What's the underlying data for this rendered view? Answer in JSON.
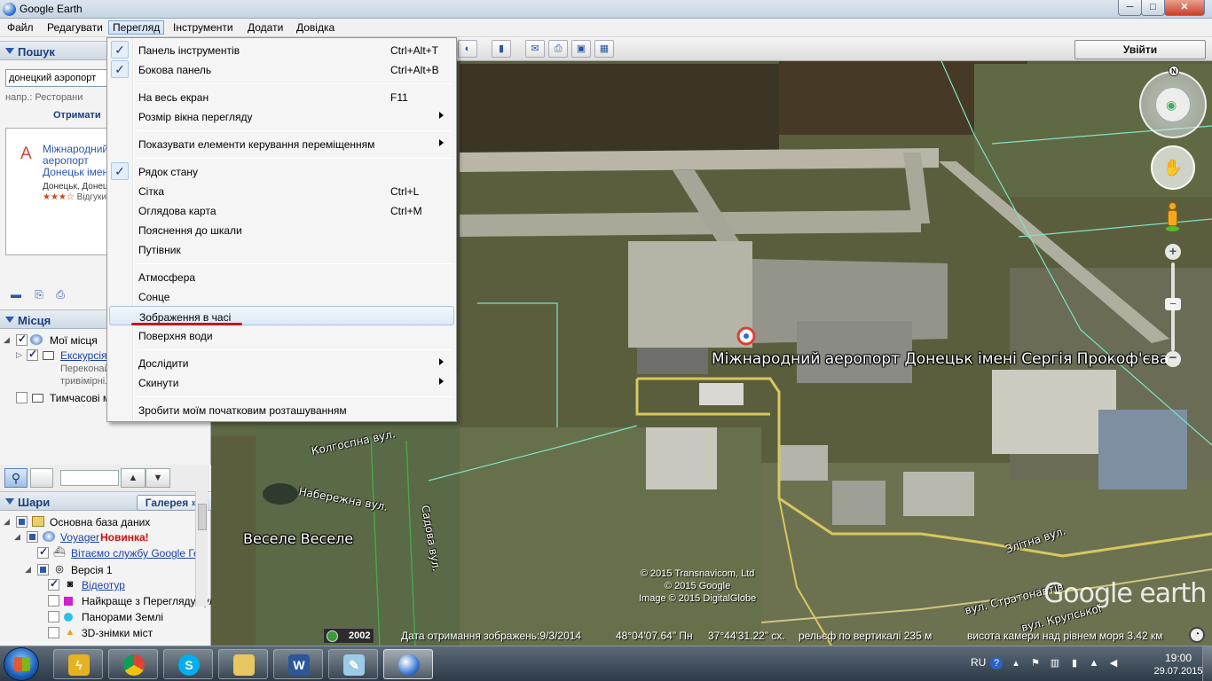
{
  "window": {
    "title": "Google Earth",
    "min": "─",
    "max": "□",
    "close": "✕"
  },
  "menubar": {
    "items": [
      "Файл",
      "Редагувати",
      "Перегляд",
      "Інструменти",
      "Додати",
      "Довідка"
    ]
  },
  "view_menu": {
    "items": [
      {
        "label": "Панель інструментів",
        "shortcut": "Ctrl+Alt+T",
        "checked": true
      },
      {
        "label": "Бокова панель",
        "shortcut": "Ctrl+Alt+B",
        "checked": true
      },
      {
        "label": "На весь екран",
        "shortcut": "F11"
      },
      {
        "label": "Розмір вікна перегляду",
        "submenu": true
      },
      {
        "label": "Показувати елементи керування переміщенням",
        "submenu": true
      },
      {
        "label": "Рядок стану",
        "checked": true
      },
      {
        "label": "Сітка",
        "shortcut": "Ctrl+L"
      },
      {
        "label": "Оглядова карта",
        "shortcut": "Ctrl+M"
      },
      {
        "label": "Пояснення до шкали"
      },
      {
        "label": "Путівник"
      },
      {
        "label": "Атмосфера"
      },
      {
        "label": "Сонце"
      },
      {
        "label": "Зображення в часі",
        "highlighted": true
      },
      {
        "label": "Поверхня води"
      },
      {
        "label": "Дослідити",
        "submenu": true
      },
      {
        "label": "Скинути",
        "submenu": true
      },
      {
        "label": "Зробити моїм початковим розташуванням"
      }
    ]
  },
  "search": {
    "header": "Пошук",
    "query": "донецкий аэропорт",
    "hint": "напр.: Ресторани",
    "get_directions": "Отримати",
    "result": {
      "marker": "A",
      "title": "Міжнародний аеропорт Донецьк імені Сергія Прокоф'єва",
      "city": "Донецьк, Донецька",
      "stars": "★★★",
      "reviews": "Відгуки"
    }
  },
  "places": {
    "header": "Місця",
    "items": [
      {
        "label": "Мої місця"
      },
      {
        "label": "Екскурсія",
        "desc1": "Переконайтеся...",
        "desc2": "тривімірні..."
      },
      {
        "label": "Тимчасові місця"
      }
    ],
    "up": "▲",
    "down": "▼"
  },
  "layers": {
    "header": "Шари",
    "gallery": "Галерея",
    "gallery_arrow": "»",
    "items": [
      {
        "label": "Основна база даних"
      },
      {
        "label": "Voyager",
        "badge": "Новинка!"
      },
      {
        "label": "Вітаємо службу Google Гео"
      },
      {
        "label": "Версія 1"
      },
      {
        "label": "Відеотур"
      },
      {
        "label": "Найкраще з Перегляду вулиць"
      },
      {
        "label": "Панорами Землі"
      },
      {
        "label": "3D-знімки міст"
      }
    ]
  },
  "toolbar": {
    "signin": "Увійти"
  },
  "map": {
    "airport_label": "Міжнародний аеропорт Донецьк імені Сергія Прокоф'єва",
    "locality_label": "Веселе  Веселе",
    "streets": [
      "Колгоспна вул.",
      "Набережна вул.",
      "Садова вул.",
      "Злітна вул.",
      "вул. Стратонавтів",
      "вул. Крупської"
    ],
    "copyright_lines": [
      "© 2015 Transnavicom, Ltd",
      "© 2015 Google",
      "Image © 2015 DigitalGlobe"
    ],
    "logo": "Google earth"
  },
  "nav": {
    "north": "N",
    "zoom_plus": "+",
    "zoom_minus": "−"
  },
  "status": {
    "year": "2002",
    "imagery_date": "Дата отримання зображень:9/3/2014",
    "lat": "48°04'07.64\" Пн",
    "lon": "37°44'31.22\" сх.",
    "elevation": "рельєф по вертикалі    235 м",
    "eye_alt": "висота камери над рівнем моря    3.42 км"
  },
  "taskbar": {
    "lang": "RU",
    "time": "19:00",
    "date": "29.07.2015"
  }
}
